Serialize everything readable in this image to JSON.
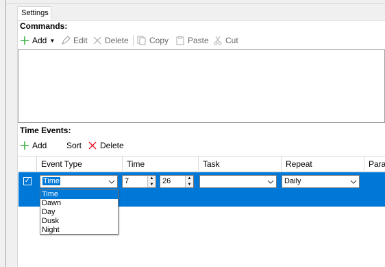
{
  "tabs": [
    {
      "label": "Settings"
    }
  ],
  "commands": {
    "title": "Commands:",
    "toolbar": {
      "add": "Add",
      "edit": "Edit",
      "delete": "Delete",
      "copy": "Copy",
      "paste": "Paste",
      "cut": "Cut"
    }
  },
  "time_events": {
    "title": "Time Events:",
    "toolbar": {
      "add": "Add",
      "sort": "Sort",
      "delete": "Delete"
    },
    "columns": [
      "Event Type",
      "Time",
      "Task",
      "Repeat",
      "Param"
    ],
    "row": {
      "checked": true,
      "event_type": "Time",
      "hour": "7",
      "minute": "26",
      "task": "",
      "repeat": "Daily"
    },
    "dropdown_options": [
      "Time",
      "Dawn",
      "Day",
      "Dusk",
      "Night"
    ]
  },
  "colors": {
    "selection": "#0078d7",
    "add_green": "#3cb043",
    "delete_red": "#e81123"
  }
}
